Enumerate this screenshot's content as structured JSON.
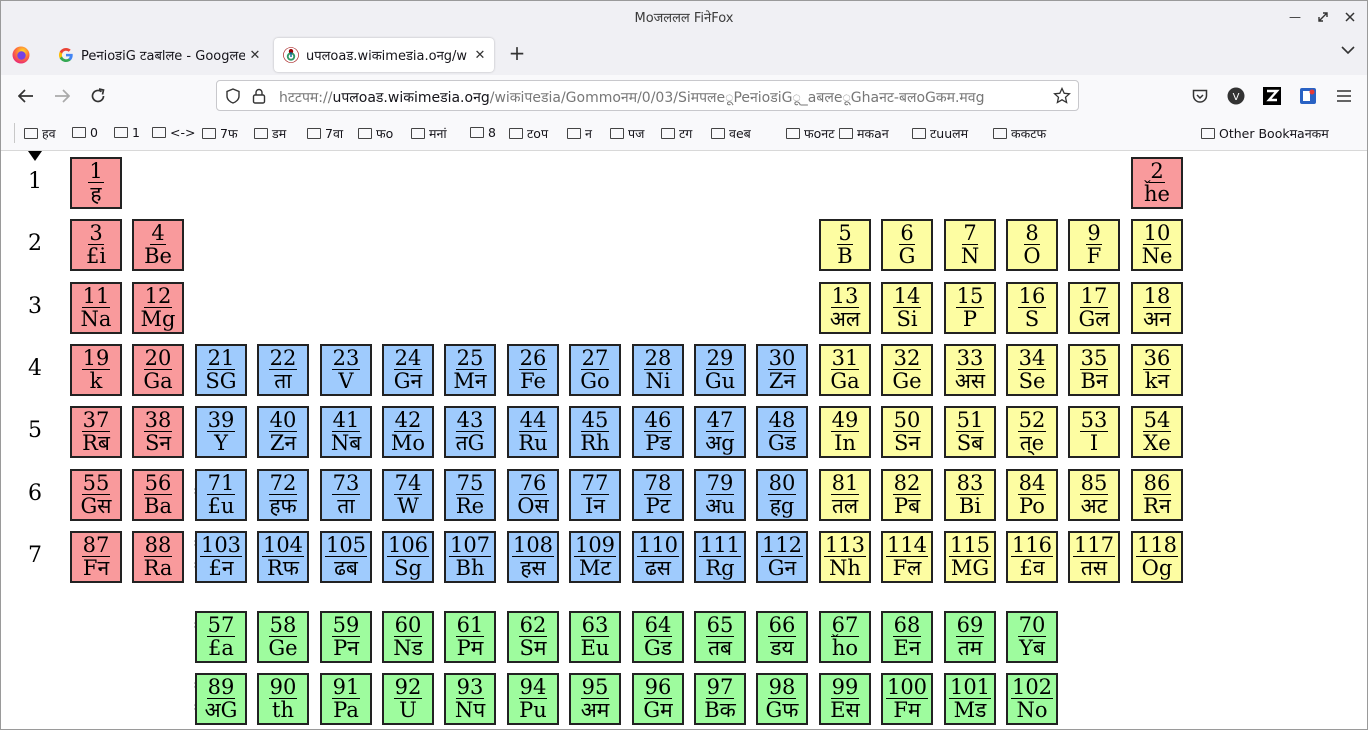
{
  "window": {
    "title": "Moजललल FiनेFox"
  },
  "tabs": [
    {
      "title": "PeनioडiG टaबlलe - Googलe",
      "favicon": "google-icon"
    },
    {
      "title": "uपलoaड.wiकimeडia.oनg/w",
      "favicon": "wikimedia-icon"
    }
  ],
  "url": {
    "host": "uपलoaड.wiकimeडia.oनg",
    "path": "/wiकiपeडia/Gommoनम/0/03/SiमपलeूPeनioडiGू_aबलeूGhaनट-बलoGकम.मवg",
    "prefix": "hटटपम://"
  },
  "bookmarks": [
    {
      "label": "हव"
    },
    {
      "label": "0"
    },
    {
      "label": "1"
    },
    {
      "label": "<->"
    },
    {
      "label": "7फ"
    },
    {
      "label": "डम"
    },
    {
      "label": "7वा"
    },
    {
      "label": "फo"
    },
    {
      "label": "मनां"
    },
    {
      "label": "8"
    },
    {
      "label": "टoप"
    },
    {
      "label": "न"
    },
    {
      "label": "पज"
    },
    {
      "label": "टग"
    },
    {
      "label": "वeब"
    },
    {
      "label": "फoनट"
    },
    {
      "label": "मकaन"
    },
    {
      "label": "टuuलम"
    },
    {
      "label": "ककटफ"
    }
  ],
  "other_bookmarks": "Other Bookमaनकम",
  "periods": [
    "1",
    "2",
    "3",
    "4",
    "5",
    "6",
    "7"
  ],
  "stars": {
    "row6": "*",
    "row7": "*\n*",
    "lanth": "*",
    "actin": "*\n*"
  },
  "colors": {
    "s_block": "#f99a9c",
    "p_block": "#fdfda2",
    "d_block": "#9fcbfd",
    "f_block": "#9efc9e"
  },
  "elements": [
    {
      "n": "1",
      "s": "ह",
      "c": 1,
      "r": 1,
      "b": "s"
    },
    {
      "n": "2",
      "s": "ȟe",
      "c": 18,
      "r": 1,
      "b": "s"
    },
    {
      "n": "3",
      "s": "£i",
      "c": 1,
      "r": 2,
      "b": "s"
    },
    {
      "n": "4",
      "s": "Be",
      "c": 2,
      "r": 2,
      "b": "s"
    },
    {
      "n": "5",
      "s": "B",
      "c": 13,
      "r": 2,
      "b": "p"
    },
    {
      "n": "6",
      "s": "G",
      "c": 14,
      "r": 2,
      "b": "p"
    },
    {
      "n": "7",
      "s": "N",
      "c": 15,
      "r": 2,
      "b": "p"
    },
    {
      "n": "8",
      "s": "O",
      "c": 16,
      "r": 2,
      "b": "p"
    },
    {
      "n": "9",
      "s": "F",
      "c": 17,
      "r": 2,
      "b": "p"
    },
    {
      "n": "10",
      "s": "Ne",
      "c": 18,
      "r": 2,
      "b": "p"
    },
    {
      "n": "11",
      "s": "Na",
      "c": 1,
      "r": 3,
      "b": "s"
    },
    {
      "n": "12",
      "s": "Mg",
      "c": 2,
      "r": 3,
      "b": "s"
    },
    {
      "n": "13",
      "s": "अल",
      "c": 13,
      "r": 3,
      "b": "p"
    },
    {
      "n": "14",
      "s": "Si",
      "c": 14,
      "r": 3,
      "b": "p"
    },
    {
      "n": "15",
      "s": "P",
      "c": 15,
      "r": 3,
      "b": "p"
    },
    {
      "n": "16",
      "s": "S",
      "c": 16,
      "r": 3,
      "b": "p"
    },
    {
      "n": "17",
      "s": "Gल",
      "c": 17,
      "r": 3,
      "b": "p"
    },
    {
      "n": "18",
      "s": "अन",
      "c": 18,
      "r": 3,
      "b": "p"
    },
    {
      "n": "19",
      "s": "k",
      "c": 1,
      "r": 4,
      "b": "s"
    },
    {
      "n": "20",
      "s": "Ga",
      "c": 2,
      "r": 4,
      "b": "s"
    },
    {
      "n": "21",
      "s": "SG",
      "c": 3,
      "r": 4,
      "b": "d"
    },
    {
      "n": "22",
      "s": "ता",
      "c": 4,
      "r": 4,
      "b": "d"
    },
    {
      "n": "23",
      "s": "V",
      "c": 5,
      "r": 4,
      "b": "d"
    },
    {
      "n": "24",
      "s": "Gन",
      "c": 6,
      "r": 4,
      "b": "d"
    },
    {
      "n": "25",
      "s": "Mन",
      "c": 7,
      "r": 4,
      "b": "d"
    },
    {
      "n": "26",
      "s": "Fe",
      "c": 8,
      "r": 4,
      "b": "d"
    },
    {
      "n": "27",
      "s": "Go",
      "c": 9,
      "r": 4,
      "b": "d"
    },
    {
      "n": "28",
      "s": "Ni",
      "c": 10,
      "r": 4,
      "b": "d"
    },
    {
      "n": "29",
      "s": "Gu",
      "c": 11,
      "r": 4,
      "b": "d"
    },
    {
      "n": "30",
      "s": "Zन",
      "c": 12,
      "r": 4,
      "b": "d"
    },
    {
      "n": "31",
      "s": "Ga",
      "c": 13,
      "r": 4,
      "b": "p"
    },
    {
      "n": "32",
      "s": "Ge",
      "c": 14,
      "r": 4,
      "b": "p"
    },
    {
      "n": "33",
      "s": "अस",
      "c": 15,
      "r": 4,
      "b": "p"
    },
    {
      "n": "34",
      "s": "Se",
      "c": 16,
      "r": 4,
      "b": "p"
    },
    {
      "n": "35",
      "s": "Bन",
      "c": 17,
      "r": 4,
      "b": "p"
    },
    {
      "n": "36",
      "s": "kन",
      "c": 18,
      "r": 4,
      "b": "p"
    },
    {
      "n": "37",
      "s": "Rब",
      "c": 1,
      "r": 5,
      "b": "s"
    },
    {
      "n": "38",
      "s": "Sन",
      "c": 2,
      "r": 5,
      "b": "s"
    },
    {
      "n": "39",
      "s": "Y",
      "c": 3,
      "r": 5,
      "b": "d"
    },
    {
      "n": "40",
      "s": "Zन",
      "c": 4,
      "r": 5,
      "b": "d"
    },
    {
      "n": "41",
      "s": "Nब",
      "c": 5,
      "r": 5,
      "b": "d"
    },
    {
      "n": "42",
      "s": "Mo",
      "c": 6,
      "r": 5,
      "b": "d"
    },
    {
      "n": "43",
      "s": "तG",
      "c": 7,
      "r": 5,
      "b": "d"
    },
    {
      "n": "44",
      "s": "Ru",
      "c": 8,
      "r": 5,
      "b": "d"
    },
    {
      "n": "45",
      "s": "Rh",
      "c": 9,
      "r": 5,
      "b": "d"
    },
    {
      "n": "46",
      "s": "Pड",
      "c": 10,
      "r": 5,
      "b": "d"
    },
    {
      "n": "47",
      "s": "अg",
      "c": 11,
      "r": 5,
      "b": "d"
    },
    {
      "n": "48",
      "s": "Gड",
      "c": 12,
      "r": 5,
      "b": "d"
    },
    {
      "n": "49",
      "s": "In",
      "c": 13,
      "r": 5,
      "b": "p"
    },
    {
      "n": "50",
      "s": "Sन",
      "c": 14,
      "r": 5,
      "b": "p"
    },
    {
      "n": "51",
      "s": "Sब",
      "c": 15,
      "r": 5,
      "b": "p"
    },
    {
      "n": "52",
      "s": "त्e",
      "c": 16,
      "r": 5,
      "b": "p"
    },
    {
      "n": "53",
      "s": "I",
      "c": 17,
      "r": 5,
      "b": "p"
    },
    {
      "n": "54",
      "s": "Xe",
      "c": 18,
      "r": 5,
      "b": "p"
    },
    {
      "n": "55",
      "s": "Gस",
      "c": 1,
      "r": 6,
      "b": "s"
    },
    {
      "n": "56",
      "s": "Ba",
      "c": 2,
      "r": 6,
      "b": "s"
    },
    {
      "n": "71",
      "s": "£u",
      "c": 3,
      "r": 6,
      "b": "d"
    },
    {
      "n": "72",
      "s": "हफ",
      "c": 4,
      "r": 6,
      "b": "d"
    },
    {
      "n": "73",
      "s": "ता",
      "c": 5,
      "r": 6,
      "b": "d"
    },
    {
      "n": "74",
      "s": "W",
      "c": 6,
      "r": 6,
      "b": "d"
    },
    {
      "n": "75",
      "s": "Re",
      "c": 7,
      "r": 6,
      "b": "d"
    },
    {
      "n": "76",
      "s": "Oस",
      "c": 8,
      "r": 6,
      "b": "d"
    },
    {
      "n": "77",
      "s": "Iन",
      "c": 9,
      "r": 6,
      "b": "d"
    },
    {
      "n": "78",
      "s": "Pट",
      "c": 10,
      "r": 6,
      "b": "d"
    },
    {
      "n": "79",
      "s": "अu",
      "c": 11,
      "r": 6,
      "b": "d"
    },
    {
      "n": "80",
      "s": "हg",
      "c": 12,
      "r": 6,
      "b": "d"
    },
    {
      "n": "81",
      "s": "तल",
      "c": 13,
      "r": 6,
      "b": "p"
    },
    {
      "n": "82",
      "s": "Pब",
      "c": 14,
      "r": 6,
      "b": "p"
    },
    {
      "n": "83",
      "s": "Bi",
      "c": 15,
      "r": 6,
      "b": "p"
    },
    {
      "n": "84",
      "s": "Po",
      "c": 16,
      "r": 6,
      "b": "p"
    },
    {
      "n": "85",
      "s": "अट",
      "c": 17,
      "r": 6,
      "b": "p"
    },
    {
      "n": "86",
      "s": "Rन",
      "c": 18,
      "r": 6,
      "b": "p"
    },
    {
      "n": "87",
      "s": "Fन",
      "c": 1,
      "r": 7,
      "b": "s"
    },
    {
      "n": "88",
      "s": "Ra",
      "c": 2,
      "r": 7,
      "b": "s"
    },
    {
      "n": "103",
      "s": "£न",
      "c": 3,
      "r": 7,
      "b": "d"
    },
    {
      "n": "104",
      "s": "Rफ",
      "c": 4,
      "r": 7,
      "b": "d"
    },
    {
      "n": "105",
      "s": "ढब",
      "c": 5,
      "r": 7,
      "b": "d"
    },
    {
      "n": "106",
      "s": "Sg",
      "c": 6,
      "r": 7,
      "b": "d"
    },
    {
      "n": "107",
      "s": "Bh",
      "c": 7,
      "r": 7,
      "b": "d"
    },
    {
      "n": "108",
      "s": "हस",
      "c": 8,
      "r": 7,
      "b": "d"
    },
    {
      "n": "109",
      "s": "Mट",
      "c": 9,
      "r": 7,
      "b": "d"
    },
    {
      "n": "110",
      "s": "ढस",
      "c": 10,
      "r": 7,
      "b": "d"
    },
    {
      "n": "111",
      "s": "Rg",
      "c": 11,
      "r": 7,
      "b": "d"
    },
    {
      "n": "112",
      "s": "Gन",
      "c": 12,
      "r": 7,
      "b": "d"
    },
    {
      "n": "113",
      "s": "Nh",
      "c": 13,
      "r": 7,
      "b": "p"
    },
    {
      "n": "114",
      "s": "Fल",
      "c": 14,
      "r": 7,
      "b": "p"
    },
    {
      "n": "115",
      "s": "MG",
      "c": 15,
      "r": 7,
      "b": "p"
    },
    {
      "n": "116",
      "s": "£व",
      "c": 16,
      "r": 7,
      "b": "p"
    },
    {
      "n": "117",
      "s": "तस",
      "c": 17,
      "r": 7,
      "b": "p"
    },
    {
      "n": "118",
      "s": "Og",
      "c": 18,
      "r": 7,
      "b": "p"
    },
    {
      "n": "57",
      "s": "£a",
      "c": 3,
      "r": 9,
      "b": "f"
    },
    {
      "n": "58",
      "s": "Ge",
      "c": 4,
      "r": 9,
      "b": "f"
    },
    {
      "n": "59",
      "s": "Pन",
      "c": 5,
      "r": 9,
      "b": "f"
    },
    {
      "n": "60",
      "s": "Nड",
      "c": 6,
      "r": 9,
      "b": "f"
    },
    {
      "n": "61",
      "s": "Pम",
      "c": 7,
      "r": 9,
      "b": "f"
    },
    {
      "n": "62",
      "s": "Sम",
      "c": 8,
      "r": 9,
      "b": "f"
    },
    {
      "n": "63",
      "s": "Eu",
      "c": 9,
      "r": 9,
      "b": "f"
    },
    {
      "n": "64",
      "s": "Gड",
      "c": 10,
      "r": 9,
      "b": "f"
    },
    {
      "n": "65",
      "s": "तब",
      "c": 11,
      "r": 9,
      "b": "f"
    },
    {
      "n": "66",
      "s": "डय",
      "c": 12,
      "r": 9,
      "b": "f"
    },
    {
      "n": "67",
      "s": "ȟo",
      "c": 13,
      "r": 9,
      "b": "f"
    },
    {
      "n": "68",
      "s": "Eन",
      "c": 14,
      "r": 9,
      "b": "f"
    },
    {
      "n": "69",
      "s": "तम",
      "c": 15,
      "r": 9,
      "b": "f"
    },
    {
      "n": "70",
      "s": "Yब",
      "c": 16,
      "r": 9,
      "b": "f"
    },
    {
      "n": "89",
      "s": "अG",
      "c": 3,
      "r": 10,
      "b": "f"
    },
    {
      "n": "90",
      "s": "th",
      "c": 4,
      "r": 10,
      "b": "f"
    },
    {
      "n": "91",
      "s": "Pa",
      "c": 5,
      "r": 10,
      "b": "f"
    },
    {
      "n": "92",
      "s": "U",
      "c": 6,
      "r": 10,
      "b": "f"
    },
    {
      "n": "93",
      "s": "Nप",
      "c": 7,
      "r": 10,
      "b": "f"
    },
    {
      "n": "94",
      "s": "Pu",
      "c": 8,
      "r": 10,
      "b": "f"
    },
    {
      "n": "95",
      "s": "अम",
      "c": 9,
      "r": 10,
      "b": "f"
    },
    {
      "n": "96",
      "s": "Gम",
      "c": 10,
      "r": 10,
      "b": "f"
    },
    {
      "n": "97",
      "s": "Bक",
      "c": 11,
      "r": 10,
      "b": "f"
    },
    {
      "n": "98",
      "s": "Gफ",
      "c": 12,
      "r": 10,
      "b": "f"
    },
    {
      "n": "99",
      "s": "Eस",
      "c": 13,
      "r": 10,
      "b": "f"
    },
    {
      "n": "100",
      "s": "Fम",
      "c": 14,
      "r": 10,
      "b": "f"
    },
    {
      "n": "101",
      "s": "Mड",
      "c": 15,
      "r": 10,
      "b": "f"
    },
    {
      "n": "102",
      "s": "No",
      "c": 16,
      "r": 10,
      "b": "f"
    }
  ]
}
